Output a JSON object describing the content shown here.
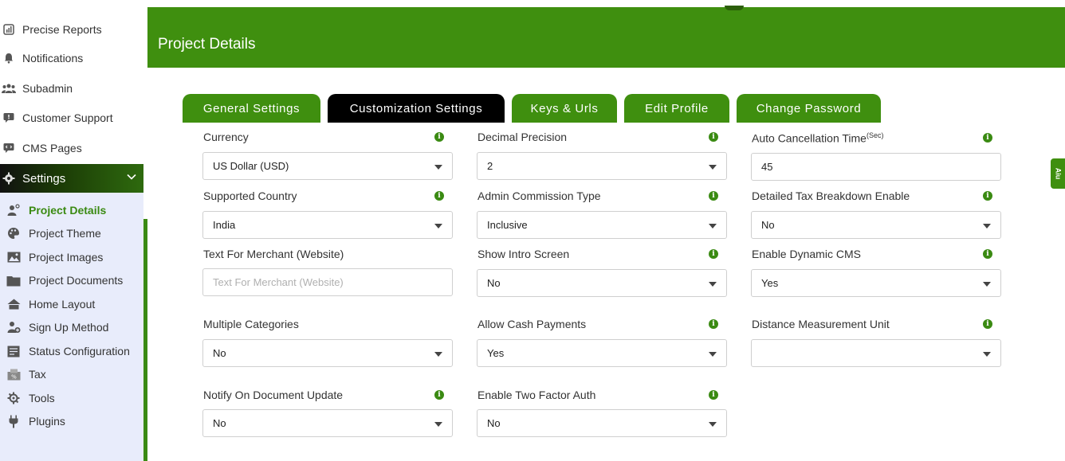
{
  "sidebar": {
    "top_items": [
      {
        "label": "Precise Reports",
        "icon": "reports-icon"
      },
      {
        "label": "Notifications",
        "icon": "bell-icon"
      },
      {
        "label": "Subadmin",
        "icon": "users-icon"
      },
      {
        "label": "Customer Support",
        "icon": "chat-icon"
      },
      {
        "label": "CMS Pages",
        "icon": "code-icon"
      }
    ],
    "settings_label": "Settings",
    "sub_items": [
      {
        "label": "Project Details",
        "icon": "project-details-icon",
        "active": true
      },
      {
        "label": "Project Theme",
        "icon": "palette-icon"
      },
      {
        "label": "Project Images",
        "icon": "image-icon"
      },
      {
        "label": "Project Documents",
        "icon": "folder-icon"
      },
      {
        "label": "Home Layout",
        "icon": "home-icon"
      },
      {
        "label": "Sign Up Method",
        "icon": "user-add-icon"
      },
      {
        "label": "Status Configuration",
        "icon": "status-icon"
      },
      {
        "label": "Tax",
        "icon": "tax-icon"
      },
      {
        "label": "Tools",
        "icon": "tools-icon"
      },
      {
        "label": "Plugins",
        "icon": "plug-icon"
      }
    ]
  },
  "header": {
    "title": "Project Details"
  },
  "colors": {
    "brand_green": "#3f8f0f",
    "active_tab": "#000000",
    "submenu_bg": "#e8ecfb"
  },
  "tabs": [
    {
      "label": "General Settings"
    },
    {
      "label": "Customization Settings",
      "active": true
    },
    {
      "label": "Keys & Urls"
    },
    {
      "label": "Edit Profile"
    },
    {
      "label": "Change Password"
    }
  ],
  "fields": {
    "currency": {
      "label": "Currency",
      "value": "US Dollar (USD)"
    },
    "decimal_precision": {
      "label": "Decimal Precision",
      "value": "2"
    },
    "auto_cancellation": {
      "label": "Auto Cancellation Time",
      "sup": "(Sec)",
      "value": "45"
    },
    "supported_country": {
      "label": "Supported Country",
      "value": "India"
    },
    "admin_commission": {
      "label": "Admin Commission Type",
      "value": "Inclusive"
    },
    "tax_breakdown": {
      "label": "Detailed Tax Breakdown Enable",
      "value": "No"
    },
    "merchant_text": {
      "label": "Text For Merchant (Website)",
      "placeholder": "Text For Merchant (Website)"
    },
    "intro_screen": {
      "label": "Show Intro Screen",
      "value": "No"
    },
    "dynamic_cms": {
      "label": "Enable Dynamic CMS",
      "value": "Yes"
    },
    "multiple_categories": {
      "label": "Multiple Categories",
      "value": "No"
    },
    "cash_payments": {
      "label": "Allow Cash Payments",
      "value": "Yes"
    },
    "distance_unit": {
      "label": "Distance Measurement Unit",
      "value": ""
    },
    "notify_doc": {
      "label": "Notify On Document Update",
      "value": "No"
    },
    "two_factor": {
      "label": "Enable Two Factor Auth",
      "value": "No"
    }
  },
  "side_tab": {
    "label": "Aiu"
  }
}
